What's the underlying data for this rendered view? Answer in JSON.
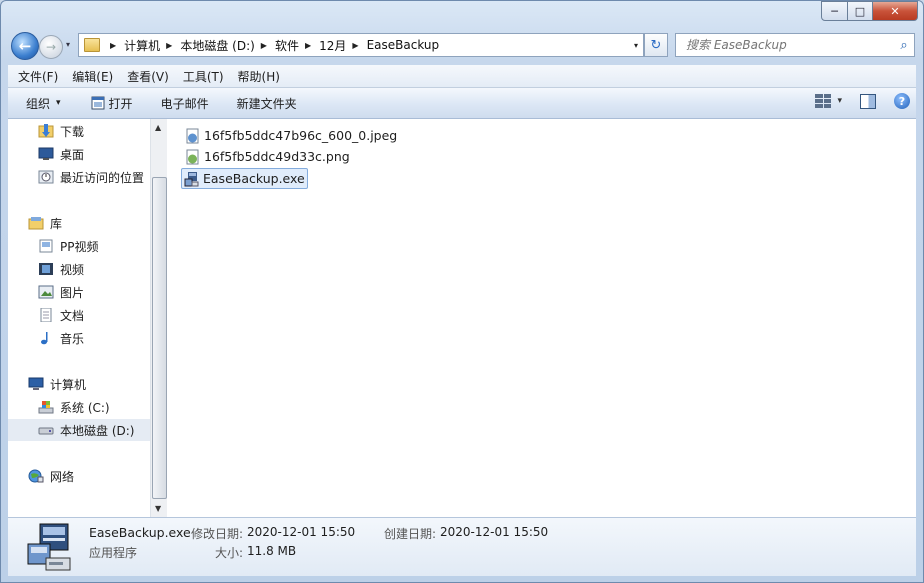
{
  "window": {
    "min_glyph": "─",
    "max_glyph": "□",
    "close_glyph": "✕"
  },
  "nav": {
    "back_glyph": "←",
    "forward_glyph": "→",
    "history_glyph": "▾",
    "refresh_glyph": "↻",
    "search_glyph": "⌕",
    "breadcrumbs": [
      "计算机",
      "本地磁盘 (D:)",
      "软件",
      "12月",
      "EaseBackup"
    ],
    "crumb_sep": "▶",
    "dropdown_glyph": "▾",
    "search_placeholder": "搜索 EaseBackup"
  },
  "menu": [
    "文件(F)",
    "编辑(E)",
    "查看(V)",
    "工具(T)",
    "帮助(H)"
  ],
  "toolbar": {
    "organize": "组织",
    "organize_arrow": "▾",
    "open": "打开",
    "email": "电子邮件",
    "new_folder": "新建文件夹",
    "view_arrow": "▾",
    "help": "?"
  },
  "sidebar": {
    "favorites": [
      {
        "label": "下载",
        "icon": "download-folder-icon"
      },
      {
        "label": "桌面",
        "icon": "desktop-icon"
      },
      {
        "label": "最近访问的位置",
        "icon": "recent-places-icon"
      }
    ],
    "libraries_label": "库",
    "libraries": [
      {
        "label": "PP视频",
        "icon": "pp-video-icon"
      },
      {
        "label": "视频",
        "icon": "video-library-icon"
      },
      {
        "label": "图片",
        "icon": "pictures-library-icon"
      },
      {
        "label": "文档",
        "icon": "documents-library-icon"
      },
      {
        "label": "音乐",
        "icon": "music-library-icon"
      }
    ],
    "computer_label": "计算机",
    "drives": [
      {
        "label": "系统 (C:)",
        "icon": "system-drive-icon"
      },
      {
        "label": "本地磁盘 (D:)",
        "icon": "local-disk-icon",
        "selected": true
      }
    ],
    "network_label": "网络",
    "scroll_up": "▲",
    "scroll_down": "▼"
  },
  "files": [
    {
      "name": "16f5fb5ddc47b96c_600_0.jpeg",
      "icon": "jpeg-file-icon",
      "selected": false
    },
    {
      "name": "16f5fb5ddc49d33c.png",
      "icon": "png-file-icon",
      "selected": false
    },
    {
      "name": "EaseBackup.exe",
      "icon": "exe-file-icon",
      "selected": true
    }
  ],
  "details": {
    "name": "EaseBackup.exe",
    "type": "应用程序",
    "modified_label": "修改日期:",
    "modified_value": "2020-12-01 15:50",
    "created_label": "创建日期:",
    "created_value": "2020-12-01 15:50",
    "size_label": "大小:",
    "size_value": "11.8 MB"
  },
  "colors": {
    "accent": "#2a6ac4",
    "selection": "#e0ecfb",
    "selection_border": "#84acdd"
  }
}
